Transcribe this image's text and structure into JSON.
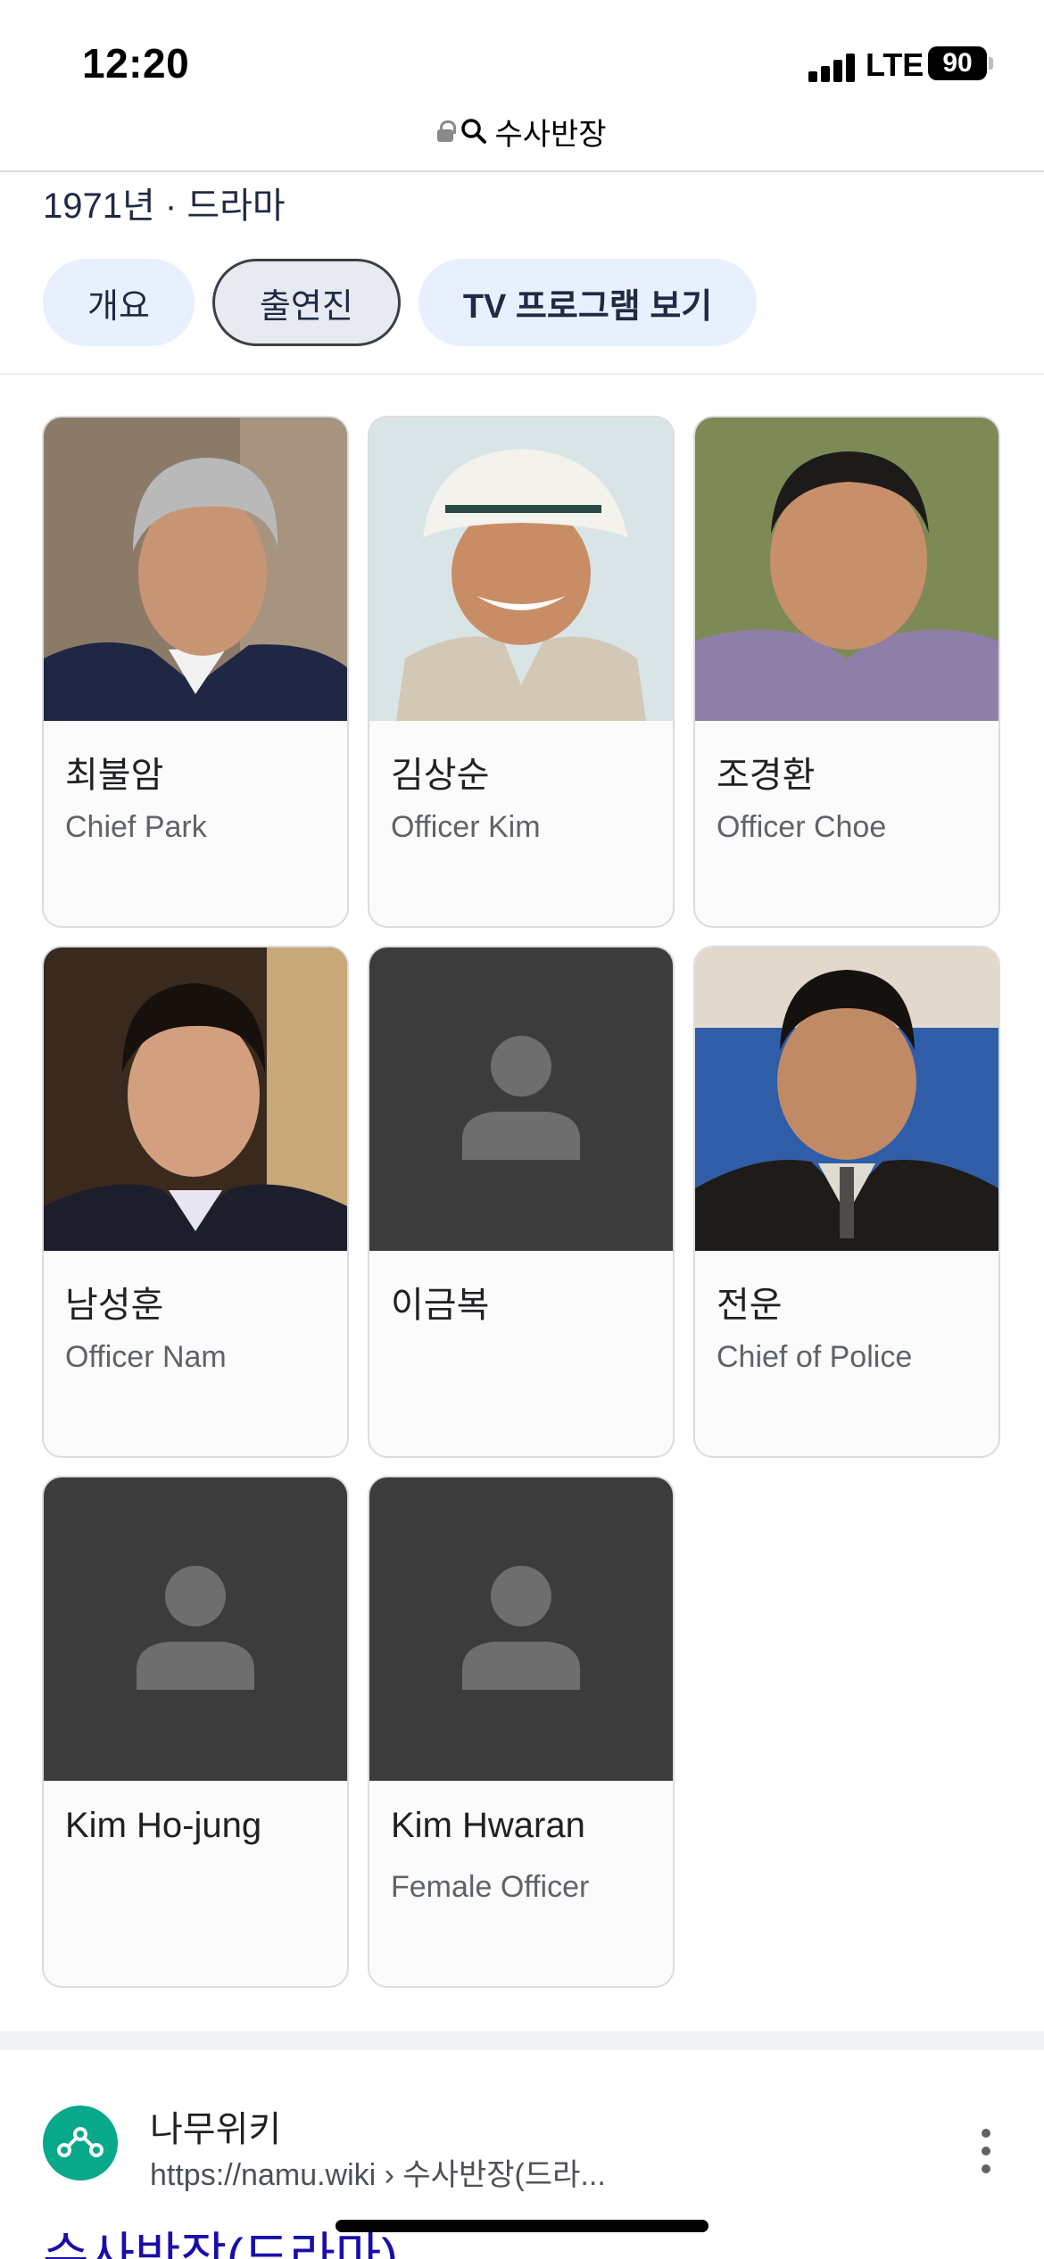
{
  "status_bar": {
    "time": "12:20",
    "network": "LTE",
    "battery": "90"
  },
  "address_bar": {
    "query": "수사반장"
  },
  "header": {
    "subtitle": "1971년 · 드라마",
    "tabs": [
      {
        "label": "개요",
        "active": false
      },
      {
        "label": "출연진",
        "active": true
      },
      {
        "label": "TV 프로그램 보기",
        "active": false
      }
    ]
  },
  "cast": [
    {
      "name": "최불암",
      "role": "Chief Park",
      "photo": "actor-photo"
    },
    {
      "name": "김상순",
      "role": "Officer Kim",
      "photo": "actor-photo"
    },
    {
      "name": "조경환",
      "role": "Officer Choe",
      "photo": "actor-photo"
    },
    {
      "name": "남성훈",
      "role": "Officer Nam",
      "photo": "actor-photo"
    },
    {
      "name": "이금복",
      "role": "",
      "photo": "person-placeholder-icon"
    },
    {
      "name": "전운",
      "role": "Chief of Police",
      "photo": "actor-photo"
    },
    {
      "name": "Kim Ho-jung",
      "role": "",
      "photo": "person-placeholder-icon"
    },
    {
      "name": "Kim Hwaran",
      "role": "Female Officer",
      "photo": "person-placeholder-icon"
    }
  ],
  "result": {
    "site_name": "나무위키",
    "url": "https://namu.wiki › 수사반장(드라...",
    "title": "수사반장(드라마)"
  },
  "colors": {
    "chip_bg": "#e8f0fe",
    "link": "#1a0dab",
    "placeholder_bg": "#3c3c3c",
    "placeholder_figure": "#6e6e6e",
    "namu_logo": "#08a88a"
  }
}
